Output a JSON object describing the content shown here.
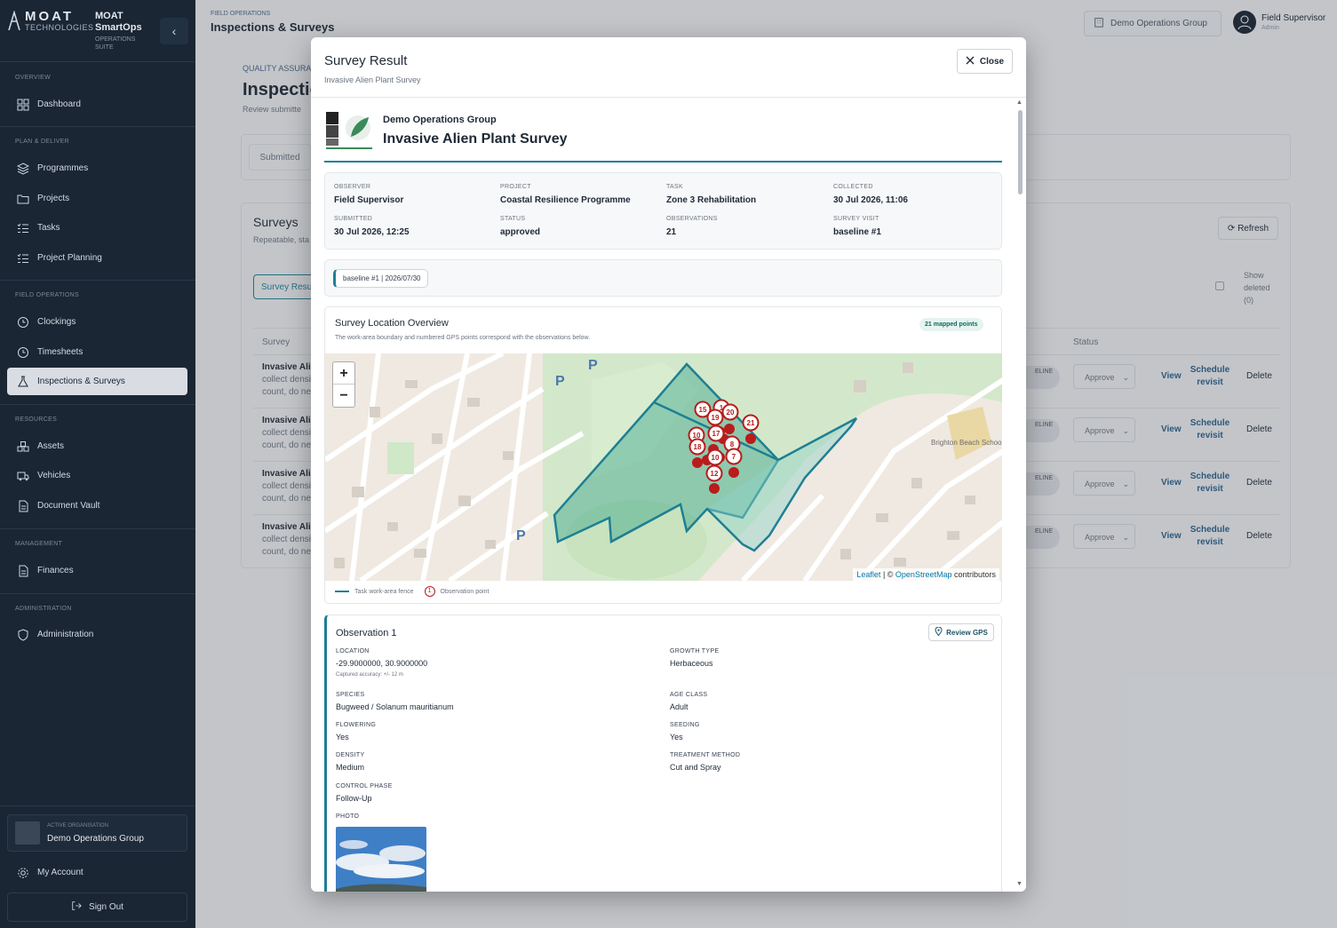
{
  "brand": {
    "moat": "MOAT",
    "technologies": "TECHNOLOGIES",
    "name": "MOAT SmartOps",
    "suite": "OPERATIONS SUITE"
  },
  "nav": {
    "overview": "OVERVIEW",
    "dashboard": "Dashboard",
    "plan": "PLAN & DELIVER",
    "programmes": "Programmes",
    "projects": "Projects",
    "tasks": "Tasks",
    "planning": "Project Planning",
    "field": "FIELD OPERATIONS",
    "clockings": "Clockings",
    "timesheets": "Timesheets",
    "inspections": "Inspections & Surveys",
    "resources": "RESOURCES",
    "assets": "Assets",
    "vehicles": "Vehicles",
    "vault": "Document Vault",
    "management": "MANAGEMENT",
    "finances": "Finances",
    "admin_sec": "ADMINISTRATION",
    "administration": "Administration",
    "active_org_label": "ACTIVE ORGANISATION",
    "active_org": "Demo Operations Group",
    "account": "My Account",
    "signout": "Sign Out"
  },
  "topbar": {
    "crumb": "FIELD OPERATIONS",
    "title": "Inspections & Surveys",
    "org": "Demo Operations Group",
    "user": "Field Supervisor",
    "role": "Admin"
  },
  "background": {
    "qa": "QUALITY ASSURA",
    "title": "Inspectic",
    "sub": "Review submitte",
    "tab": "Submitted",
    "surveys": "Surveys",
    "surveys_sub": "Repeatable, sta",
    "survey_btn": "Survey Resu",
    "refresh": "Refresh",
    "show_deleted": "Show deleted (0)",
    "col_survey": "Survey",
    "col_status": "Status",
    "rows": [
      {
        "name": "Invasive Alie",
        "l2": "collect densi",
        "l3": "count, do ne",
        "badge": "ELINE",
        "status": "Approve",
        "view": "View",
        "revisit": "Schedule revisit",
        "delete": "Delete"
      },
      {
        "name": "Invasive Alie",
        "l2": "collect densi",
        "l3": "count, do ne",
        "badge": "ELINE",
        "status": "Approve",
        "view": "View",
        "revisit": "Schedule revisit",
        "delete": "Delete"
      },
      {
        "name": "Invasive Alie",
        "l2": "collect densi",
        "l3": "count, do ne",
        "badge": "ELINE",
        "status": "Approve",
        "view": "View",
        "revisit": "Schedule revisit",
        "delete": "Delete"
      },
      {
        "name": "Invasive Alie",
        "l2": "collect densi",
        "l3": "count, do ne",
        "badge": "ELINE",
        "status": "Approve",
        "view": "View",
        "revisit": "Schedule revisit",
        "delete": "Delete"
      }
    ]
  },
  "modal": {
    "title": "Survey Result",
    "subtitle": "Invasive Alien Plant Survey",
    "close": "Close",
    "report_org": "Demo Operations Group",
    "report_title": "Invasive Alien Plant Survey",
    "meta": {
      "observer_k": "OBSERVER",
      "observer": "Field Supervisor",
      "project_k": "PROJECT",
      "project": "Coastal Resilience Programme",
      "task_k": "TASK",
      "task": "Zone 3 Rehabilitation",
      "collected_k": "COLLECTED",
      "collected": "30 Jul 2026, 11:06",
      "submitted_k": "SUBMITTED",
      "submitted": "30 Jul 2026, 12:25",
      "status_k": "STATUS",
      "status": "approved",
      "observations_k": "OBSERVATIONS",
      "observations": "21",
      "visit_k": "SURVEY VISIT",
      "visit": "baseline #1"
    },
    "visit_chip": "baseline #1 | 2026/07/30",
    "location": {
      "title": "Survey Location Overview",
      "subtitle": "The work-area boundary and numbered GPS points correspond with the observations below.",
      "mapped": "21 mapped points",
      "zoom_in": "+",
      "zoom_out": "−",
      "attr_leaflet": "Leaflet",
      "attr_mid": " | © ",
      "attr_osm": "OpenStreetMap",
      "attr_end": " contributors",
      "legend_fence": "Task work-area fence",
      "legend_point": "Observation point",
      "legend_point_num": "1",
      "school": "Brighton Beach School",
      "parking": "P"
    },
    "observation": {
      "title": "Observation 1",
      "review_gps": "Review GPS",
      "location_k": "LOCATION",
      "location": "-29.9000000, 30.9000000",
      "accuracy": "Captured accuracy: +/- 12 m",
      "growth_k": "GROWTH TYPE",
      "growth": "Herbaceous",
      "species_k": "SPECIES",
      "species": "Bugweed / Solanum mauritianum",
      "age_k": "AGE CLASS",
      "age": "Adult",
      "flowering_k": "FLOWERING",
      "flowering": "Yes",
      "seeding_k": "SEEDING",
      "seeding": "Yes",
      "density_k": "DENSITY",
      "density": "Medium",
      "treatment_k": "TREATMENT METHOD",
      "treatment": "Cut and Spray",
      "phase_k": "CONTROL PHASE",
      "phase": "Follow-Up",
      "photo_k": "PHOTO"
    },
    "map_markers": [
      "15",
      "1",
      "20",
      "19",
      "21",
      "17",
      "10",
      "18",
      "8",
      "7",
      "10",
      "12"
    ]
  },
  "colors": {
    "sidebar": "#1a2634",
    "accent": "#1e7f94",
    "marker": "#b91c1c",
    "fence_fill": "#3aa58a"
  }
}
